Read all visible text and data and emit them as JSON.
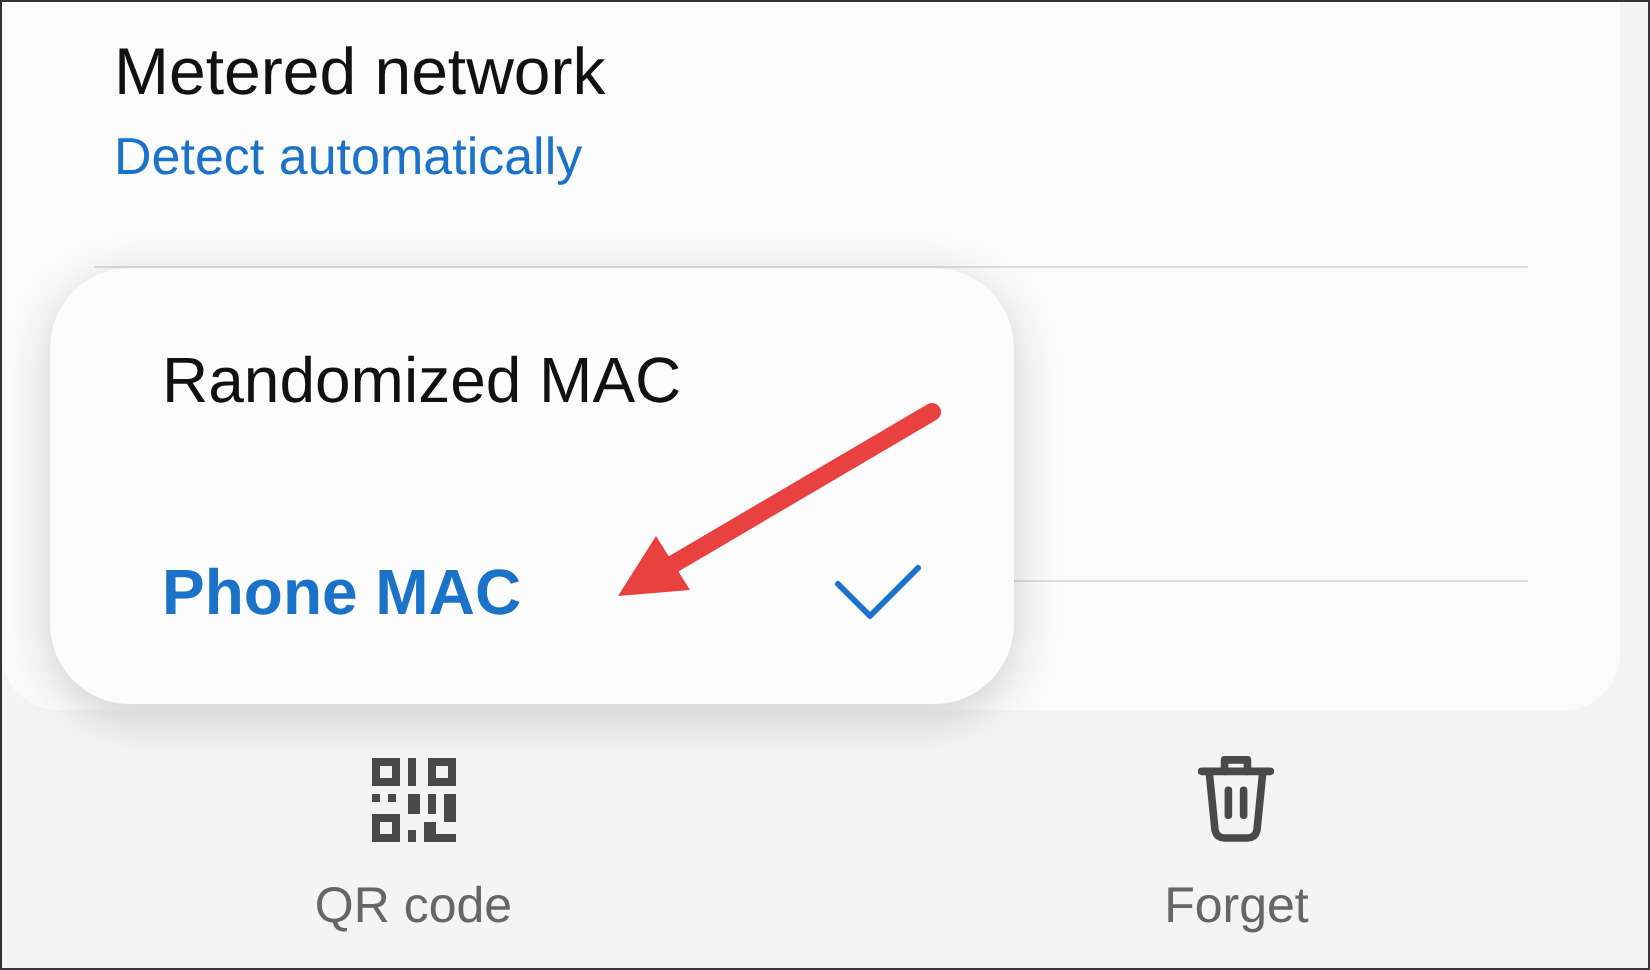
{
  "settings": [
    {
      "title": "Metered network",
      "value": "Detect automatically"
    }
  ],
  "menu": {
    "options": [
      {
        "label": "Randomized MAC",
        "selected": false
      },
      {
        "label": "Phone MAC",
        "selected": true
      }
    ]
  },
  "bottom_bar": [
    {
      "label": "QR code",
      "kind": "qr"
    },
    {
      "label": "Forget",
      "kind": "trash"
    }
  ]
}
